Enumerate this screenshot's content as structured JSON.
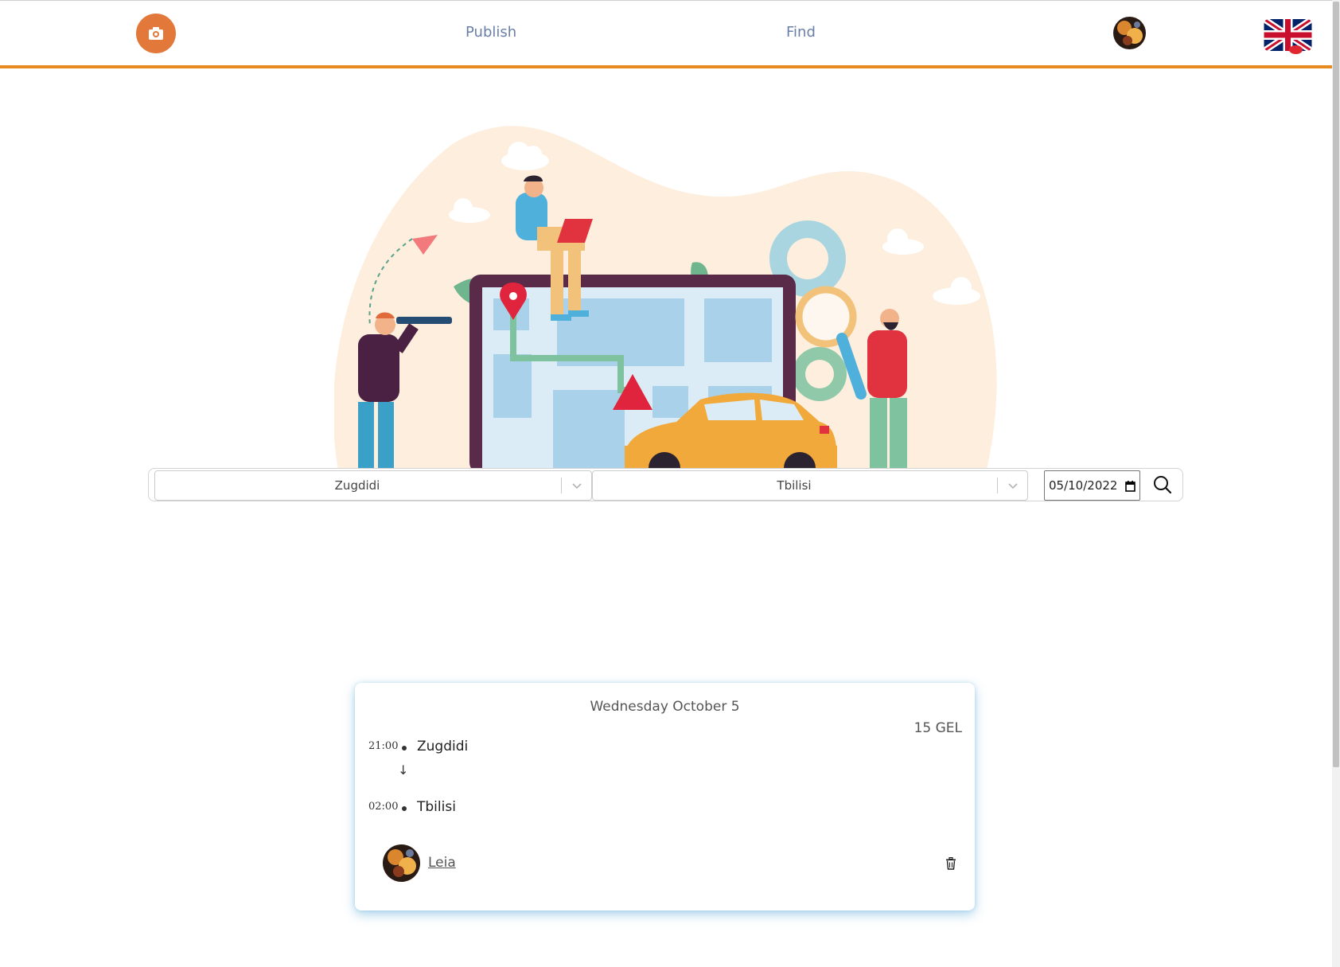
{
  "nav": {
    "logo_icon": "camera-icon",
    "publish_label": "Publish",
    "find_label": "Find",
    "language_icon": "uk-flag-icon",
    "brand_color": "#e88a1f"
  },
  "search": {
    "from_value": "Zugdidi",
    "to_value": "Tbilisi",
    "date_value": "05/10/2022",
    "search_icon": "search-icon"
  },
  "ride": {
    "date": "Wednesday October 5",
    "price": "15 GEL",
    "departure_time": "21:00",
    "departure_city": "Zugdidi",
    "arrow": "↓",
    "arrival_time": "02:00",
    "arrival_city": "Tbilisi",
    "driver_name": "Leia",
    "delete_icon": "trash-icon"
  }
}
